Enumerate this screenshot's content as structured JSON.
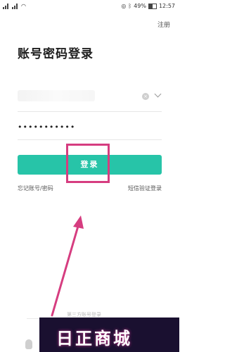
{
  "status_bar": {
    "battery": "49%",
    "time": "12:57"
  },
  "header": {
    "register_label": "注册"
  },
  "main": {
    "title": "账号密码登录",
    "password_masked": "•••••••••••",
    "login_label": "登录",
    "forgot_label": "忘记账号/密码",
    "sms_label": "短信验证登录",
    "third_party_label": "第三方账号登录"
  },
  "watermark": {
    "text": "日正商城"
  },
  "colors": {
    "accent": "#27c4a8",
    "highlight": "#d63d80"
  }
}
